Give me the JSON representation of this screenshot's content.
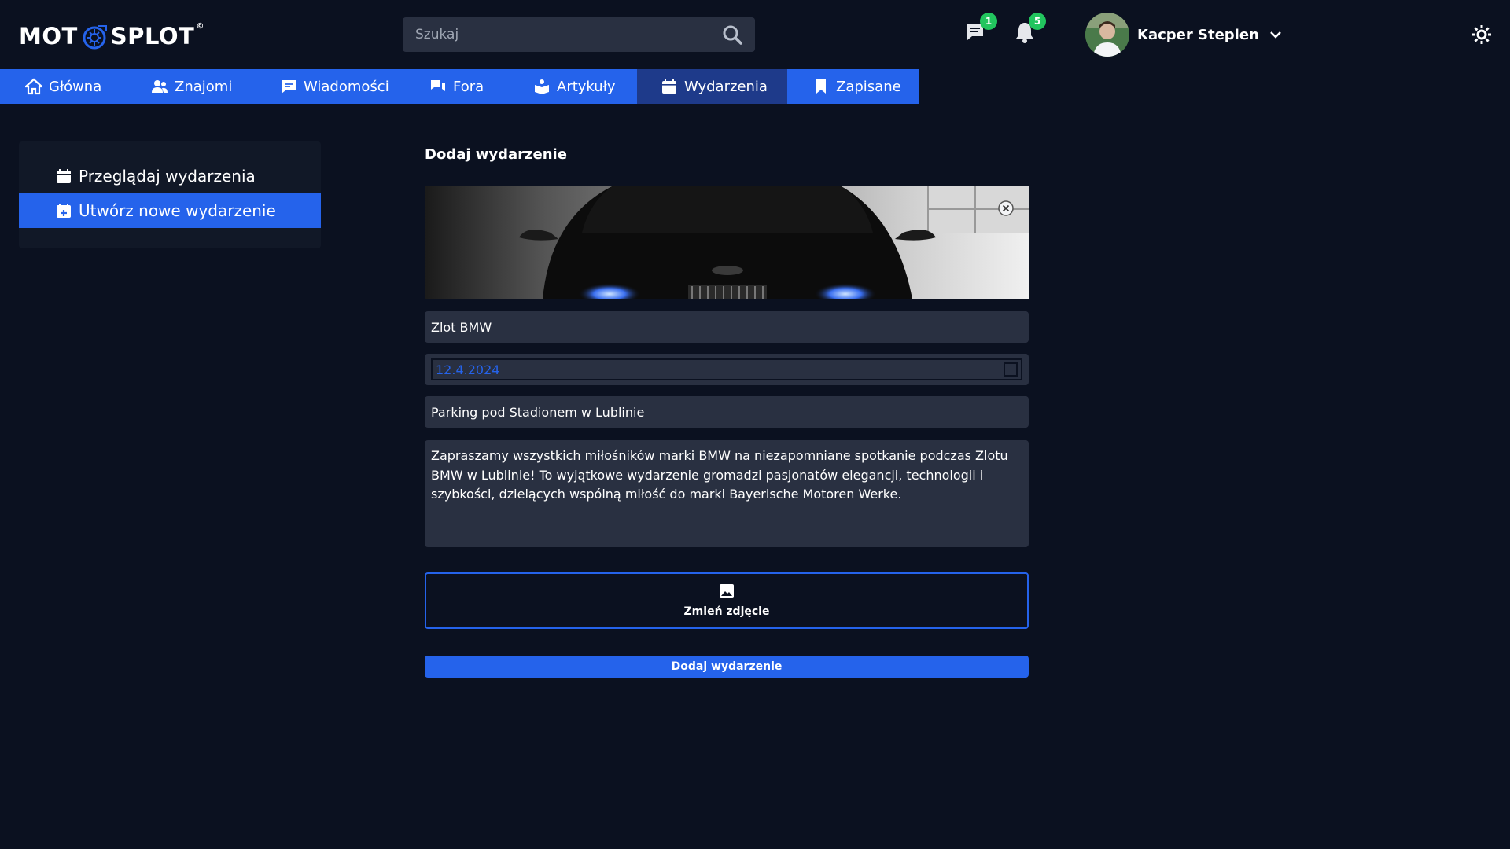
{
  "brand": {
    "logo_left": "MOT",
    "logo_right": "SPLOT",
    "accent": "#2563eb"
  },
  "search": {
    "placeholder": "Szukaj"
  },
  "header": {
    "messages_badge": "1",
    "notifications_badge": "5",
    "user_name": "Kacper Stepien"
  },
  "nav": {
    "items": [
      {
        "label": "Główna",
        "icon": "home-icon"
      },
      {
        "label": "Znajomi",
        "icon": "users-icon"
      },
      {
        "label": "Wiadomości",
        "icon": "message-icon"
      },
      {
        "label": "Fora",
        "icon": "forum-icon"
      },
      {
        "label": "Artykuły",
        "icon": "articles-icon"
      },
      {
        "label": "Wydarzenia",
        "icon": "calendar-icon"
      },
      {
        "label": "Zapisane",
        "icon": "bookmark-icon"
      }
    ],
    "active": "Wydarzenia"
  },
  "sidebar": {
    "items": [
      {
        "label": "Przeglądaj wydarzenia",
        "icon": "calendar-icon"
      },
      {
        "label": "Utwórz nowe wydarzenie",
        "icon": "calendar-plus-icon"
      }
    ]
  },
  "form": {
    "title": "Dodaj wydarzenie",
    "name_value": "Zlot BMW",
    "date_value": "12.4.2024",
    "location_value": "Parking pod Stadionem w Lublinie",
    "description_value": "Zapraszamy wszystkich miłośników marki BMW na niezapomniane spotkanie podczas Zlotu BMW w Lublinie! To wyjątkowe wydarzenie gromadzi pasjonatów elegancji, technologii i szybkości, dzielących wspólną miłość do marki Bayerische Motoren Werke.",
    "change_photo_label": "Zmień zdjęcie",
    "submit_label": "Dodaj wydarzenie"
  }
}
